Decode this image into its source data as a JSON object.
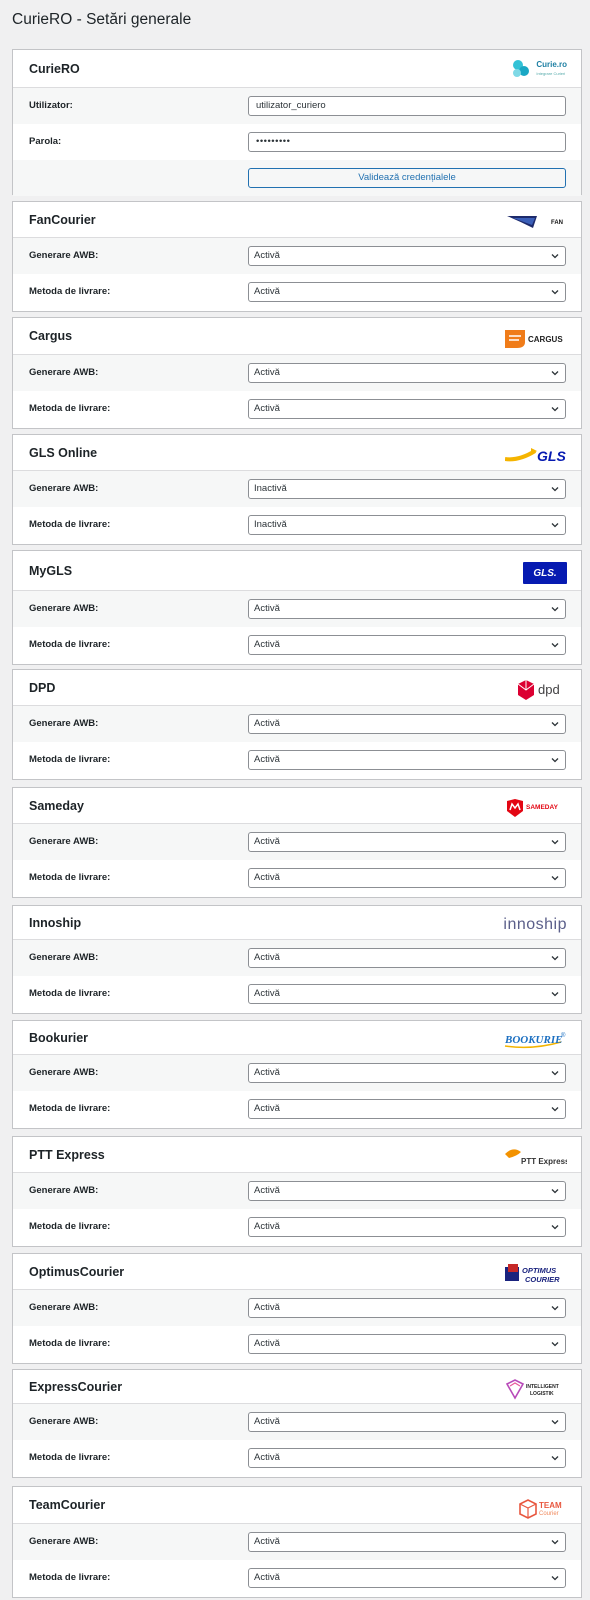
{
  "page": {
    "title": "CurieRO - Setări generale"
  },
  "curiero": {
    "title": "CurieRO",
    "logo_text": "Curie.ro",
    "logo_subtext": "Integrare Curieri",
    "user_label": "Utilizator:",
    "user_value": "utilizator_curiero",
    "pass_label": "Parola:",
    "pass_value": "•••••••••",
    "validate_label": "Validează credențialele"
  },
  "common": {
    "awb_label": "Generare AWB:",
    "delivery_label": "Metoda de livrare:"
  },
  "couriers": [
    {
      "title": "FanCourier",
      "logo": "FAN",
      "awb": "Activă",
      "delivery": "Activă"
    },
    {
      "title": "Cargus",
      "logo": "CARGUS",
      "awb": "Activă",
      "delivery": "Activă"
    },
    {
      "title": "GLS Online",
      "logo": "GLS",
      "awb": "Inactivă",
      "delivery": "Inactivă"
    },
    {
      "title": "MyGLS",
      "logo": "GLS.",
      "awb": "Activă",
      "delivery": "Activă"
    },
    {
      "title": "DPD",
      "logo": "dpd",
      "awb": "Activă",
      "delivery": "Activă"
    },
    {
      "title": "Sameday",
      "logo": "SAMEDAY",
      "awb": "Activă",
      "delivery": "Activă"
    },
    {
      "title": "Innoship",
      "logo": "innoship",
      "awb": "Activă",
      "delivery": "Activă"
    },
    {
      "title": "Bookurier",
      "logo": "BOOKURIE",
      "awb": "Activă",
      "delivery": "Activă"
    },
    {
      "title": "PTT Express",
      "logo": "PTT Express",
      "awb": "Activă",
      "delivery": "Activă"
    },
    {
      "title": "OptimusCourier",
      "logo": "OPTIMUS COURIER",
      "awb": "Activă",
      "delivery": "Activă"
    },
    {
      "title": "ExpressCourier",
      "logo": "INTELLIGENT LOGISTIK",
      "awb": "Activă",
      "delivery": "Activă"
    },
    {
      "title": "TeamCourier",
      "logo": "TEAM Courier",
      "awb": "Activă",
      "delivery": "Activă"
    }
  ],
  "colors": {
    "accent": "#2271b1",
    "fan": "#1d2a6b",
    "cargus": "#f07c19",
    "gls": "#f5b400",
    "gls_blue": "#061ab1",
    "dpd": "#dc0032",
    "sameday": "#e30613",
    "innoship": "#5b5f8a",
    "bookurier": "#1b6fc1",
    "ptt": "#f39200",
    "optimus": "#1a237e",
    "express": "#b84ab9",
    "team": "#e8573f"
  }
}
